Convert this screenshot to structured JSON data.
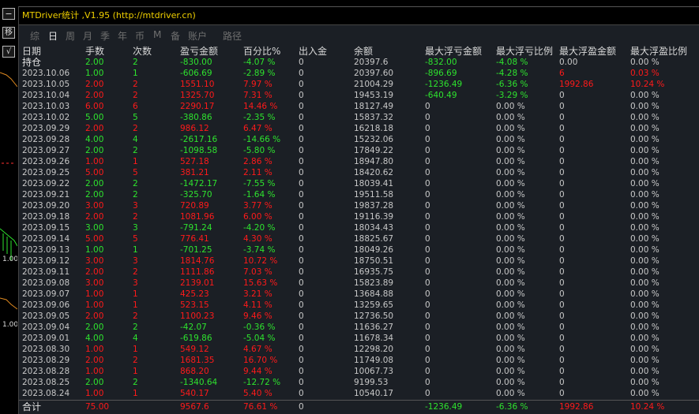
{
  "title": "MTDriver统计 ,V1.95 (http://mtdriver.cn)",
  "left_panel": {
    "minimize": "−",
    "move": "移",
    "tick": "√",
    "price_labels": [
      "1.00",
      "1.00"
    ]
  },
  "tabs": [
    {
      "label": "综",
      "active": false
    },
    {
      "label": "日",
      "active": true
    },
    {
      "label": "周",
      "active": false
    },
    {
      "label": "月",
      "active": false
    },
    {
      "label": "季",
      "active": false
    },
    {
      "label": "年",
      "active": false
    },
    {
      "label": "币",
      "active": false
    },
    {
      "label": "M",
      "active": false
    },
    {
      "label": "备",
      "active": false
    },
    {
      "label": "账户",
      "active": false
    },
    {
      "label": "路径",
      "active": false
    }
  ],
  "columns": [
    "日期",
    "手数",
    "次数",
    "盈亏金额",
    "百分比%",
    "出入金",
    "余额",
    "最大浮亏金额",
    "最大浮亏比例",
    "最大浮盈金额",
    "最大浮盈比例"
  ],
  "rows": [
    [
      "持仓",
      "2.00",
      "2",
      "-830.00",
      "-4.07 %",
      "0",
      "20397.6",
      "-832.00",
      "-4.08 %",
      "0.00",
      "0.00 %"
    ],
    [
      "2023.10.06",
      "1.00",
      "1",
      "-606.69",
      "-2.89 %",
      "0",
      "20397.60",
      "-896.69",
      "-4.28 %",
      "6",
      "0.03 %"
    ],
    [
      "2023.10.05",
      "2.00",
      "2",
      "1551.10",
      "7.97 %",
      "0",
      "21004.29",
      "-1236.49",
      "-6.36 %",
      "1992.86",
      "10.24 %"
    ],
    [
      "2023.10.04",
      "2.00",
      "2",
      "1325.70",
      "7.31 %",
      "0",
      "19453.19",
      "-640.49",
      "-3.29 %",
      "0",
      "0.00 %"
    ],
    [
      "2023.10.03",
      "6.00",
      "6",
      "2290.17",
      "14.46 %",
      "0",
      "18127.49",
      "0",
      "0.00 %",
      "0",
      "0.00 %"
    ],
    [
      "2023.10.02",
      "5.00",
      "5",
      "-380.86",
      "-2.35 %",
      "0",
      "15837.32",
      "0",
      "0.00 %",
      "0",
      "0.00 %"
    ],
    [
      "2023.09.29",
      "2.00",
      "2",
      "986.12",
      "6.47 %",
      "0",
      "16218.18",
      "0",
      "0.00 %",
      "0",
      "0.00 %"
    ],
    [
      "2023.09.28",
      "4.00",
      "4",
      "-2617.16",
      "-14.66 %",
      "0",
      "15232.06",
      "0",
      "0.00 %",
      "0",
      "0.00 %"
    ],
    [
      "2023.09.27",
      "2.00",
      "2",
      "-1098.58",
      "-5.80 %",
      "0",
      "17849.22",
      "0",
      "0.00 %",
      "0",
      "0.00 %"
    ],
    [
      "2023.09.26",
      "1.00",
      "1",
      "527.18",
      "2.86 %",
      "0",
      "18947.80",
      "0",
      "0.00 %",
      "0",
      "0.00 %"
    ],
    [
      "2023.09.25",
      "5.00",
      "5",
      "381.21",
      "2.11 %",
      "0",
      "18420.62",
      "0",
      "0.00 %",
      "0",
      "0.00 %"
    ],
    [
      "2023.09.22",
      "2.00",
      "2",
      "-1472.17",
      "-7.55 %",
      "0",
      "18039.41",
      "0",
      "0.00 %",
      "0",
      "0.00 %"
    ],
    [
      "2023.09.21",
      "2.00",
      "2",
      "-325.70",
      "-1.64 %",
      "0",
      "19511.58",
      "0",
      "0.00 %",
      "0",
      "0.00 %"
    ],
    [
      "2023.09.20",
      "3.00",
      "3",
      "720.89",
      "3.77 %",
      "0",
      "19837.28",
      "0",
      "0.00 %",
      "0",
      "0.00 %"
    ],
    [
      "2023.09.18",
      "2.00",
      "2",
      "1081.96",
      "6.00 %",
      "0",
      "19116.39",
      "0",
      "0.00 %",
      "0",
      "0.00 %"
    ],
    [
      "2023.09.15",
      "3.00",
      "3",
      "-791.24",
      "-4.20 %",
      "0",
      "18034.43",
      "0",
      "0.00 %",
      "0",
      "0.00 %"
    ],
    [
      "2023.09.14",
      "5.00",
      "5",
      "776.41",
      "4.30 %",
      "0",
      "18825.67",
      "0",
      "0.00 %",
      "0",
      "0.00 %"
    ],
    [
      "2023.09.13",
      "1.00",
      "1",
      "-701.25",
      "-3.74 %",
      "0",
      "18049.26",
      "0",
      "0.00 %",
      "0",
      "0.00 %"
    ],
    [
      "2023.09.12",
      "3.00",
      "3",
      "1814.76",
      "10.72 %",
      "0",
      "18750.51",
      "0",
      "0.00 %",
      "0",
      "0.00 %"
    ],
    [
      "2023.09.11",
      "2.00",
      "2",
      "1111.86",
      "7.03 %",
      "0",
      "16935.75",
      "0",
      "0.00 %",
      "0",
      "0.00 %"
    ],
    [
      "2023.09.08",
      "3.00",
      "3",
      "2139.01",
      "15.63 %",
      "0",
      "15823.89",
      "0",
      "0.00 %",
      "0",
      "0.00 %"
    ],
    [
      "2023.09.07",
      "1.00",
      "1",
      "425.23",
      "3.21 %",
      "0",
      "13684.88",
      "0",
      "0.00 %",
      "0",
      "0.00 %"
    ],
    [
      "2023.09.06",
      "1.00",
      "1",
      "523.15",
      "4.11 %",
      "0",
      "13259.65",
      "0",
      "0.00 %",
      "0",
      "0.00 %"
    ],
    [
      "2023.09.05",
      "2.00",
      "2",
      "1100.23",
      "9.46 %",
      "0",
      "12736.50",
      "0",
      "0.00 %",
      "0",
      "0.00 %"
    ],
    [
      "2023.09.04",
      "2.00",
      "2",
      "-42.07",
      "-0.36 %",
      "0",
      "11636.27",
      "0",
      "0.00 %",
      "0",
      "0.00 %"
    ],
    [
      "2023.09.01",
      "4.00",
      "4",
      "-619.86",
      "-5.04 %",
      "0",
      "11678.34",
      "0",
      "0.00 %",
      "0",
      "0.00 %"
    ],
    [
      "2023.08.30",
      "1.00",
      "1",
      "549.12",
      "4.67 %",
      "0",
      "12298.20",
      "0",
      "0.00 %",
      "0",
      "0.00 %"
    ],
    [
      "2023.08.29",
      "2.00",
      "2",
      "1681.35",
      "16.70 %",
      "0",
      "11749.08",
      "0",
      "0.00 %",
      "0",
      "0.00 %"
    ],
    [
      "2023.08.28",
      "1.00",
      "1",
      "868.20",
      "9.44 %",
      "0",
      "10067.73",
      "0",
      "0.00 %",
      "0",
      "0.00 %"
    ],
    [
      "2023.08.25",
      "2.00",
      "2",
      "-1340.64",
      "-12.72 %",
      "0",
      "9199.53",
      "0",
      "0.00 %",
      "0",
      "0.00 %"
    ],
    [
      "2023.08.24",
      "1.00",
      "1",
      "540.17",
      "5.40 %",
      "0",
      "10540.17",
      "0",
      "0.00 %",
      "0",
      "0.00 %"
    ]
  ],
  "total": [
    "合计",
    "75.00",
    "",
    "9567.6",
    "76.61 %",
    "0",
    "",
    "-1236.49",
    "-6.36 %",
    "1992.86",
    "10.24 %"
  ],
  "colors": {
    "profit": "#ff1a1a",
    "loss": "#2ee32e",
    "title": "#f0d000",
    "panel_bg": "#1b1f25"
  }
}
